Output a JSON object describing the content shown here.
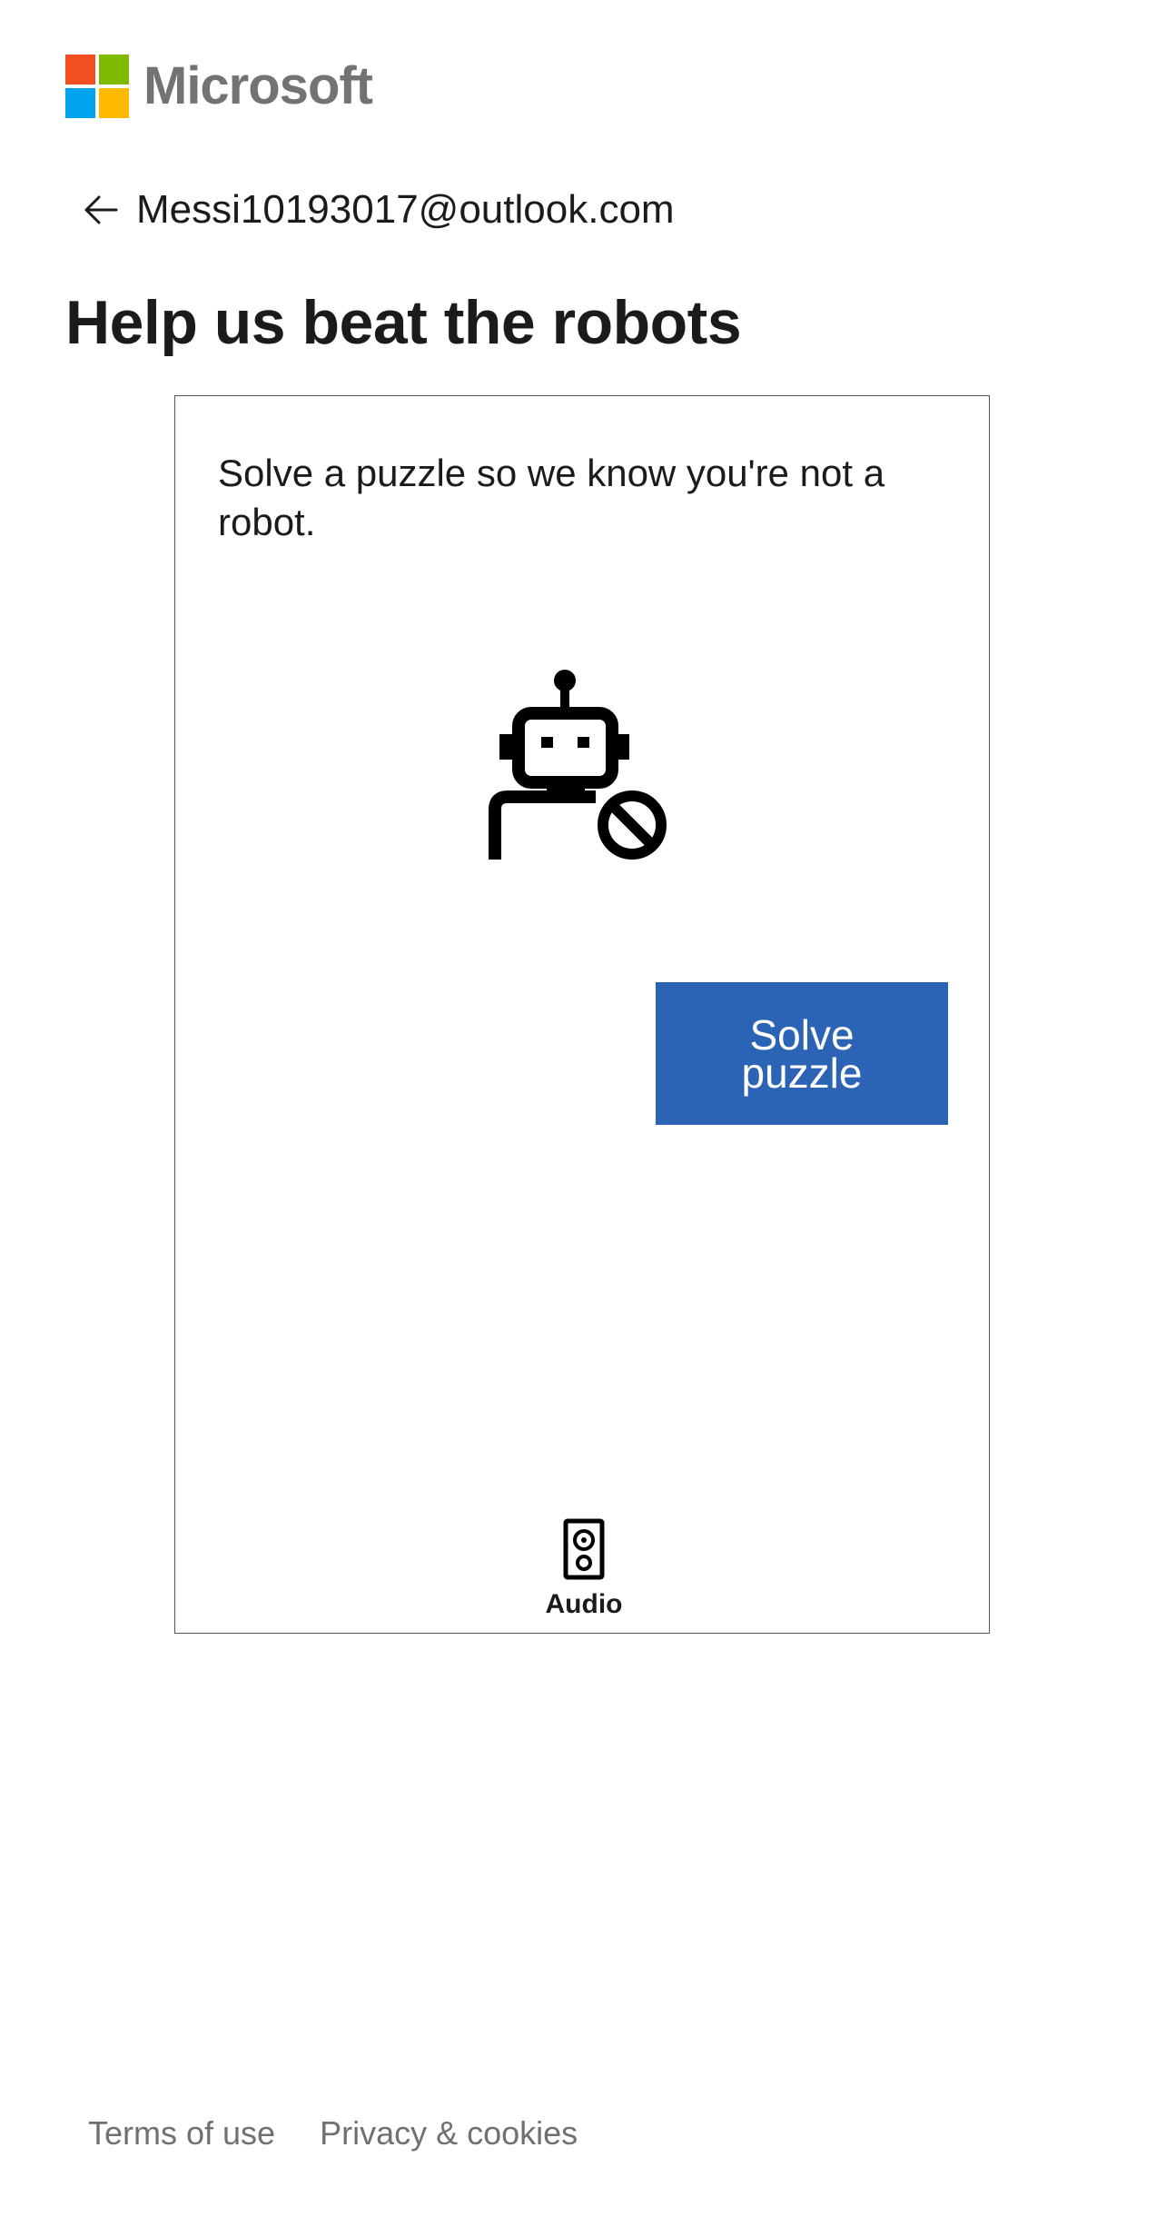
{
  "brand": {
    "name": "Microsoft",
    "colors": {
      "red": "#f25022",
      "green": "#7fba00",
      "blue": "#00a4ef",
      "yellow": "#ffb900",
      "text": "#737373"
    }
  },
  "identity": {
    "back_icon": "arrow-left-icon",
    "email": "Messi10193017@outlook.com"
  },
  "page": {
    "title": "Help us beat the robots"
  },
  "puzzle": {
    "instructions": "Solve a puzzle so we know you're not a robot.",
    "illustration_icon": "robot-blocked-icon",
    "solve_button_label": "Solve puzzle",
    "solve_button_color": "#2b64b5",
    "audio_icon": "speaker-icon",
    "audio_label": "Audio"
  },
  "footer": {
    "terms_label": "Terms of use",
    "privacy_label": "Privacy & cookies"
  }
}
